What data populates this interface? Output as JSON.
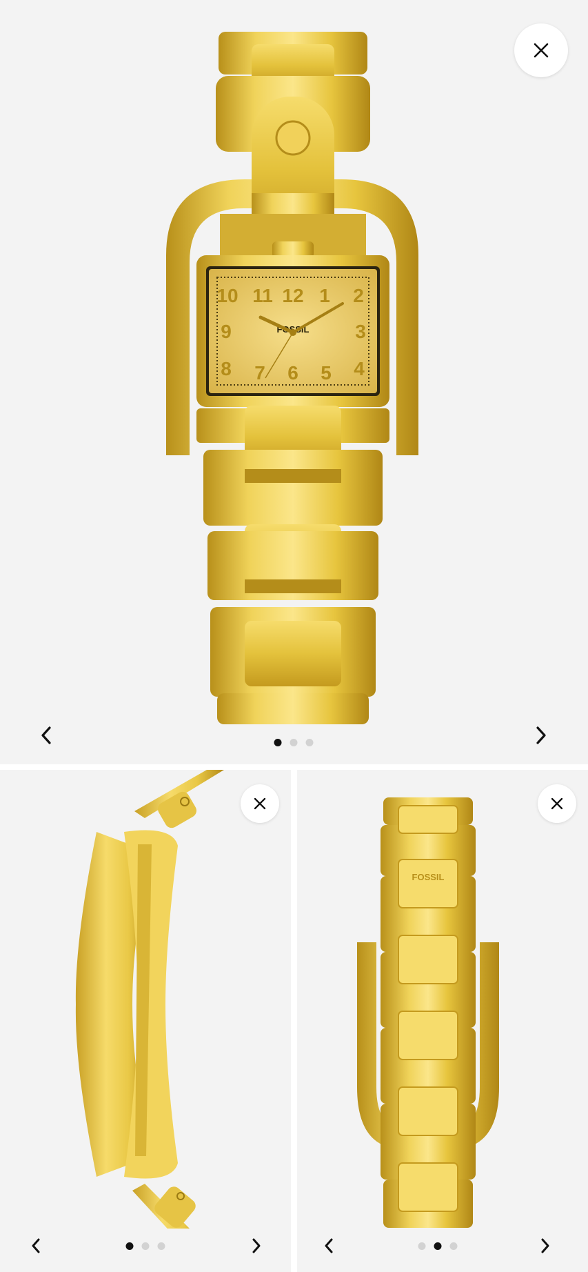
{
  "brand_mark": "FOSSIL",
  "dial_numerals": [
    "10",
    "11",
    "12",
    "1",
    "2",
    "9",
    "3",
    "8",
    "7",
    "6",
    "5",
    "4"
  ],
  "colors": {
    "background": "#f3f3f3",
    "gold": "#e2bf35",
    "dot_active": "#111111",
    "dot_inactive": "#d2d2d2"
  },
  "main_viewer": {
    "close_icon": "close-icon",
    "prev_icon": "chevron-left-icon",
    "next_icon": "chevron-right-icon",
    "dots_total": 3,
    "active_dot": 1
  },
  "thumb_left": {
    "close_icon": "close-icon",
    "prev_icon": "chevron-left-icon",
    "next_icon": "chevron-right-icon",
    "dots_total": 3,
    "active_dot": 1
  },
  "thumb_right": {
    "close_icon": "close-icon",
    "prev_icon": "chevron-left-icon",
    "next_icon": "chevron-right-icon",
    "dots_total": 3,
    "active_dot": 2
  }
}
